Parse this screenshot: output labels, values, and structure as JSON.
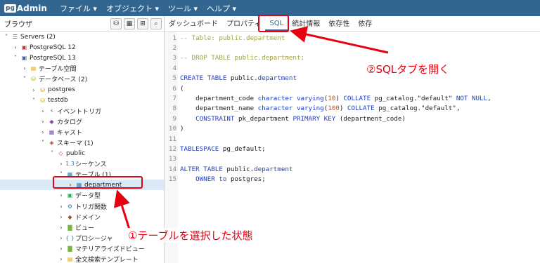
{
  "app": {
    "logo_pg": "pg",
    "logo_admin": "Admin"
  },
  "menu": [
    "ファイル ▾",
    "オブジェクト ▾",
    "ツール ▾",
    "ヘルプ ▾"
  ],
  "left_panel": {
    "title": "ブラウザ"
  },
  "tabs": [
    "ダッシュボード",
    "プロパティ",
    "SQL",
    "統計情報",
    "依存性",
    "依存"
  ],
  "active_tab": "SQL",
  "tree": [
    {
      "indent": 0,
      "chev": "˅",
      "icon": "server-group-icon",
      "glyph": "☰",
      "color": "#555",
      "label": "Servers (2)"
    },
    {
      "indent": 1,
      "chev": "›",
      "icon": "server-icon",
      "glyph": "▣",
      "color": "#c0392b",
      "label": "PostgreSQL 12"
    },
    {
      "indent": 1,
      "chev": "˅",
      "icon": "server-icon",
      "glyph": "▣",
      "color": "#3468a5",
      "label": "PostgreSQL 13"
    },
    {
      "indent": 2,
      "chev": "›",
      "icon": "tablespace-icon",
      "glyph": "▤",
      "color": "#d6a400",
      "label": "テーブル空間"
    },
    {
      "indent": 2,
      "chev": "˅",
      "icon": "databases-icon",
      "glyph": "⛁",
      "color": "#d6a400",
      "label": "データベース (2)"
    },
    {
      "indent": 3,
      "chev": "›",
      "icon": "database-icon",
      "glyph": "⛁",
      "color": "#d6a400",
      "label": "postgres"
    },
    {
      "indent": 3,
      "chev": "˅",
      "icon": "database-icon",
      "glyph": "⛁",
      "color": "#d6a400",
      "label": "testdb"
    },
    {
      "indent": 4,
      "chev": "›",
      "icon": "event-trigger-icon",
      "glyph": "⚡",
      "color": "#2c7fb8",
      "label": "イベントトリガ"
    },
    {
      "indent": 4,
      "chev": "›",
      "icon": "catalog-icon",
      "glyph": "◆",
      "color": "#8e44ad",
      "label": "カタログ"
    },
    {
      "indent": 4,
      "chev": "›",
      "icon": "cast-icon",
      "glyph": "▦",
      "color": "#7d5ba6",
      "label": "キャスト"
    },
    {
      "indent": 4,
      "chev": "˅",
      "icon": "schemas-icon",
      "glyph": "◈",
      "color": "#c0392b",
      "label": "スキーマ (1)"
    },
    {
      "indent": 5,
      "chev": "˅",
      "icon": "schema-icon",
      "glyph": "◇",
      "color": "#c0392b",
      "label": "public"
    },
    {
      "indent": 6,
      "chev": "›",
      "icon": "sequence-icon",
      "glyph": "1.3",
      "color": "#2c7fb8",
      "label": "シーケンス"
    },
    {
      "indent": 6,
      "chev": "˅",
      "icon": "tables-icon",
      "glyph": "▦",
      "color": "#2c7fb8",
      "label": "テーブル (1)"
    },
    {
      "indent": 7,
      "chev": "›",
      "icon": "table-icon",
      "glyph": "▦",
      "color": "#2c7fb8",
      "label": "department",
      "selected": true
    },
    {
      "indent": 6,
      "chev": "›",
      "icon": "datatype-icon",
      "glyph": "▣",
      "color": "#27ae60",
      "label": "データ型"
    },
    {
      "indent": 6,
      "chev": "›",
      "icon": "trigger-function-icon",
      "glyph": "⚙",
      "color": "#2c7fb8",
      "label": "トリガ関数"
    },
    {
      "indent": 6,
      "chev": "›",
      "icon": "domain-icon",
      "glyph": "◆",
      "color": "#a0522d",
      "label": "ドメイン"
    },
    {
      "indent": 6,
      "chev": "›",
      "icon": "view-icon",
      "glyph": "▇",
      "color": "#7cb342",
      "label": "ビュー"
    },
    {
      "indent": 6,
      "chev": "›",
      "icon": "procedure-icon",
      "glyph": "{ }",
      "color": "#2c7fb8",
      "label": "プロシージャ"
    },
    {
      "indent": 6,
      "chev": "›",
      "icon": "materialized-view-icon",
      "glyph": "▇",
      "color": "#7cb342",
      "label": "マテリアライズドビュー"
    },
    {
      "indent": 6,
      "chev": "›",
      "icon": "fts-template-icon",
      "glyph": "▤",
      "color": "#d6a400",
      "label": "全文検索テンプレート"
    }
  ],
  "code": [
    [
      [
        "cm",
        "-- Table: public.department"
      ]
    ],
    [],
    [
      [
        "cm",
        "-- DROP TABLE public.department;"
      ]
    ],
    [],
    [
      [
        "kw",
        "CREATE TABLE "
      ],
      [
        "id",
        "public"
      ],
      [
        "id",
        "."
      ],
      [
        "ty",
        "department"
      ]
    ],
    [
      [
        "id",
        "("
      ]
    ],
    [
      [
        "id",
        "    department_code "
      ],
      [
        "ty",
        "character varying"
      ],
      [
        "id",
        "("
      ],
      [
        "nu",
        "10"
      ],
      [
        "id",
        ") "
      ],
      [
        "kw",
        "COLLATE "
      ],
      [
        "id",
        "pg_catalog."
      ],
      [
        "st",
        "\"default\" "
      ],
      [
        "kw",
        "NOT NULL"
      ],
      [
        "id",
        ","
      ]
    ],
    [
      [
        "id",
        "    department_name "
      ],
      [
        "ty",
        "character varying"
      ],
      [
        "id",
        "("
      ],
      [
        "nu",
        "100"
      ],
      [
        "id",
        ") "
      ],
      [
        "kw",
        "COLLATE "
      ],
      [
        "id",
        "pg_catalog."
      ],
      [
        "st",
        "\"default\""
      ],
      [
        "id",
        ","
      ]
    ],
    [
      [
        "id",
        "    "
      ],
      [
        "kw",
        "CONSTRAINT "
      ],
      [
        "id",
        "pk_department "
      ],
      [
        "kw",
        "PRIMARY KEY "
      ],
      [
        "id",
        "(department_code)"
      ]
    ],
    [
      [
        "id",
        ")"
      ]
    ],
    [],
    [
      [
        "kw",
        "TABLESPACE "
      ],
      [
        "id",
        "pg_default;"
      ]
    ],
    [],
    [
      [
        "kw",
        "ALTER TABLE "
      ],
      [
        "id",
        "public"
      ],
      [
        "id",
        "."
      ],
      [
        "ty",
        "department"
      ]
    ],
    [
      [
        "id",
        "    "
      ],
      [
        "kw",
        "OWNER to "
      ],
      [
        "id",
        "postgres;"
      ]
    ]
  ],
  "annotations": {
    "sql_tab_note": "②SQLタブを開く",
    "select_note": "①テーブルを選択した状態"
  },
  "colors": {
    "header_bg": "#326690",
    "annotation_red": "#e60012"
  }
}
